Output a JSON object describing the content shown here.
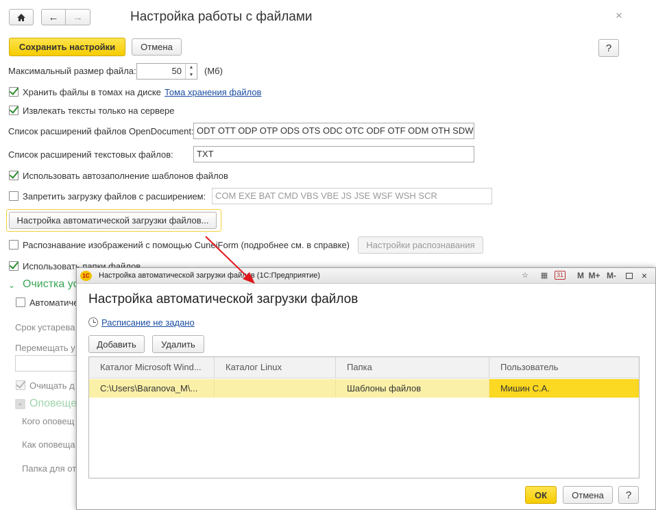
{
  "window": {
    "title": "Настройка работы с файлами",
    "close": "×",
    "help": "?"
  },
  "toolbar": {
    "save_label": "Сохранить настройки",
    "cancel_label": "Отмена"
  },
  "form": {
    "max_size_label": "Максимальный размер файла:",
    "max_size_value": "50",
    "max_size_unit": "(Мб)",
    "store_volumes_label": "Хранить файлы в томах на диске",
    "volumes_link": "Тома хранения файлов",
    "extract_server_label": "Извлекать тексты только на сервере",
    "opendoc_label": "Список расширений файлов OpenDocument:",
    "opendoc_value": "ODT OTT ODP OTP ODS OTS ODC OTC ODF OTF ODM OTH SDW",
    "text_ext_label": "Список расширений текстовых файлов:",
    "text_ext_value": "TXT",
    "autofill_label": "Использовать автозаполнение шаблонов файлов",
    "deny_upload_label": "Запретить загрузку файлов с расширением:",
    "deny_upload_value": "COM EXE BAT CMD VBS VBE JS JSE WSF WSH SCR",
    "auto_upload_btn": "Настройка автоматической загрузки файлов...",
    "cuneiform_label": "Распознавание изображений с помощью CuneiForm (подробнее см. в справке)",
    "recog_btn": "Настройки распознавания",
    "use_folders_label": "Использовать папки файлов",
    "cleanup_label": "Очистка уста",
    "auto_label": "Автоматиче",
    "obsolete_label": "Срок устарева",
    "move_label": "Перемещать у",
    "clear_label": "Очищать д",
    "notify_label": "Оповеще",
    "who_label": "Кого оповещ",
    "how_label": "Как оповеща",
    "folder_label": "Папка для от"
  },
  "dialog": {
    "window_title": "Настройка автоматической загрузки файлов  (1С:Предприятие)",
    "heading": "Настройка автоматической загрузки файлов",
    "schedule_link": "Расписание не задано",
    "add_btn": "Добавить",
    "delete_btn": "Удалить",
    "ok_btn": "ОК",
    "cancel_btn": "Отмена",
    "help_btn": "?",
    "titlebar_m": "M",
    "titlebar_mplus": "M+",
    "titlebar_mminus": "M-",
    "titlebar_calendar": "31",
    "logo": "1С",
    "columns": [
      "Каталог Microsoft Wind...",
      "Каталог Linux",
      "Папка",
      "Пользователь"
    ],
    "rows": [
      [
        "C:\\Users\\Baranova_M\\...",
        "",
        "Шаблоны файлов",
        "Мишин С.А."
      ]
    ]
  },
  "colors": {
    "accent_yellow": "#f5cc00",
    "selected_row": "#fbf0a8",
    "selected_cell": "#fbd821",
    "link_blue": "#1a4da1",
    "arrow_red": "#e0161c",
    "green_group": "#3aa655"
  }
}
